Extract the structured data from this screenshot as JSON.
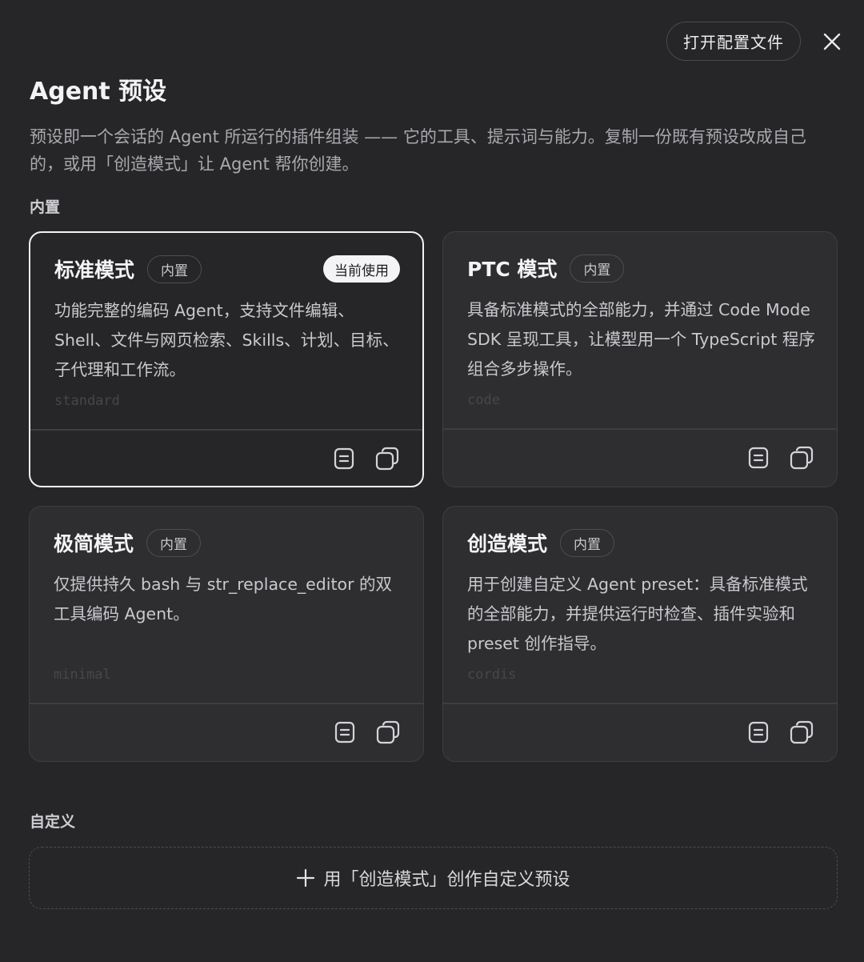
{
  "header": {
    "open_config_label": "打开配置文件",
    "title": "Agent 预设",
    "description": "预设即一个会话的 Agent 所运行的插件组装 —— 它的工具、提示词与能力。复制一份既有预设改成自己的，或用「创造模式」让 Agent 帮你创建。"
  },
  "builtin_section_label": "内置",
  "cards": [
    {
      "title": "标准模式",
      "badge": "内置",
      "current_label": "当前使用",
      "description": "功能完整的编码 Agent，支持文件编辑、Shell、文件与网页检索、Skills、计划、目标、子代理和工作流。",
      "id": "standard"
    },
    {
      "title": "PTC 模式",
      "badge": "内置",
      "description": "具备标准模式的全部能力，并通过 Code Mode SDK 呈现工具，让模型用一个 TypeScript 程序组合多步操作。",
      "id": "code"
    },
    {
      "title": "极简模式",
      "badge": "内置",
      "description": "仅提供持久 bash 与 str_replace_editor 的双工具编码 Agent。",
      "id": "minimal"
    },
    {
      "title": "创造模式",
      "badge": "内置",
      "description": "用于创建自定义 Agent preset：具备标准模式的全部能力，并提供运行时检查、插件实验和 preset 创作指导。",
      "id": "cordis"
    }
  ],
  "custom_section_label": "自定义",
  "add_custom_label": "用「创造模式」创作自定义预设",
  "icons": {
    "close": "close-icon",
    "view": "document-icon",
    "copy": "copy-icon",
    "add": "plus-icon"
  }
}
